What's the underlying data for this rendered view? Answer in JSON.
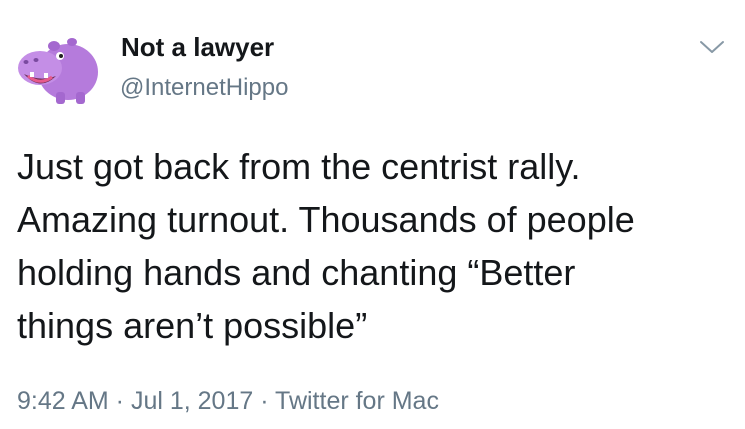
{
  "tweet": {
    "display_name": "Not a lawyer",
    "handle": "@InternetHippo",
    "text_lines": [
      "Just got back from the centrist rally.",
      "Amazing turnout. Thousands of people",
      "holding hands and chanting “Better",
      "things aren’t possible”"
    ],
    "time": "9:42 AM",
    "separator": " · ",
    "date": "Jul 1, 2017",
    "source": "Twitter for Mac",
    "avatar_icon": "purple-hippo-avatar",
    "menu_icon": "chevron-down-icon"
  },
  "colors": {
    "primary_text": "#14171a",
    "secondary_text": "#657786",
    "avatar_purple": "#b57bdc",
    "background": "#ffffff"
  }
}
